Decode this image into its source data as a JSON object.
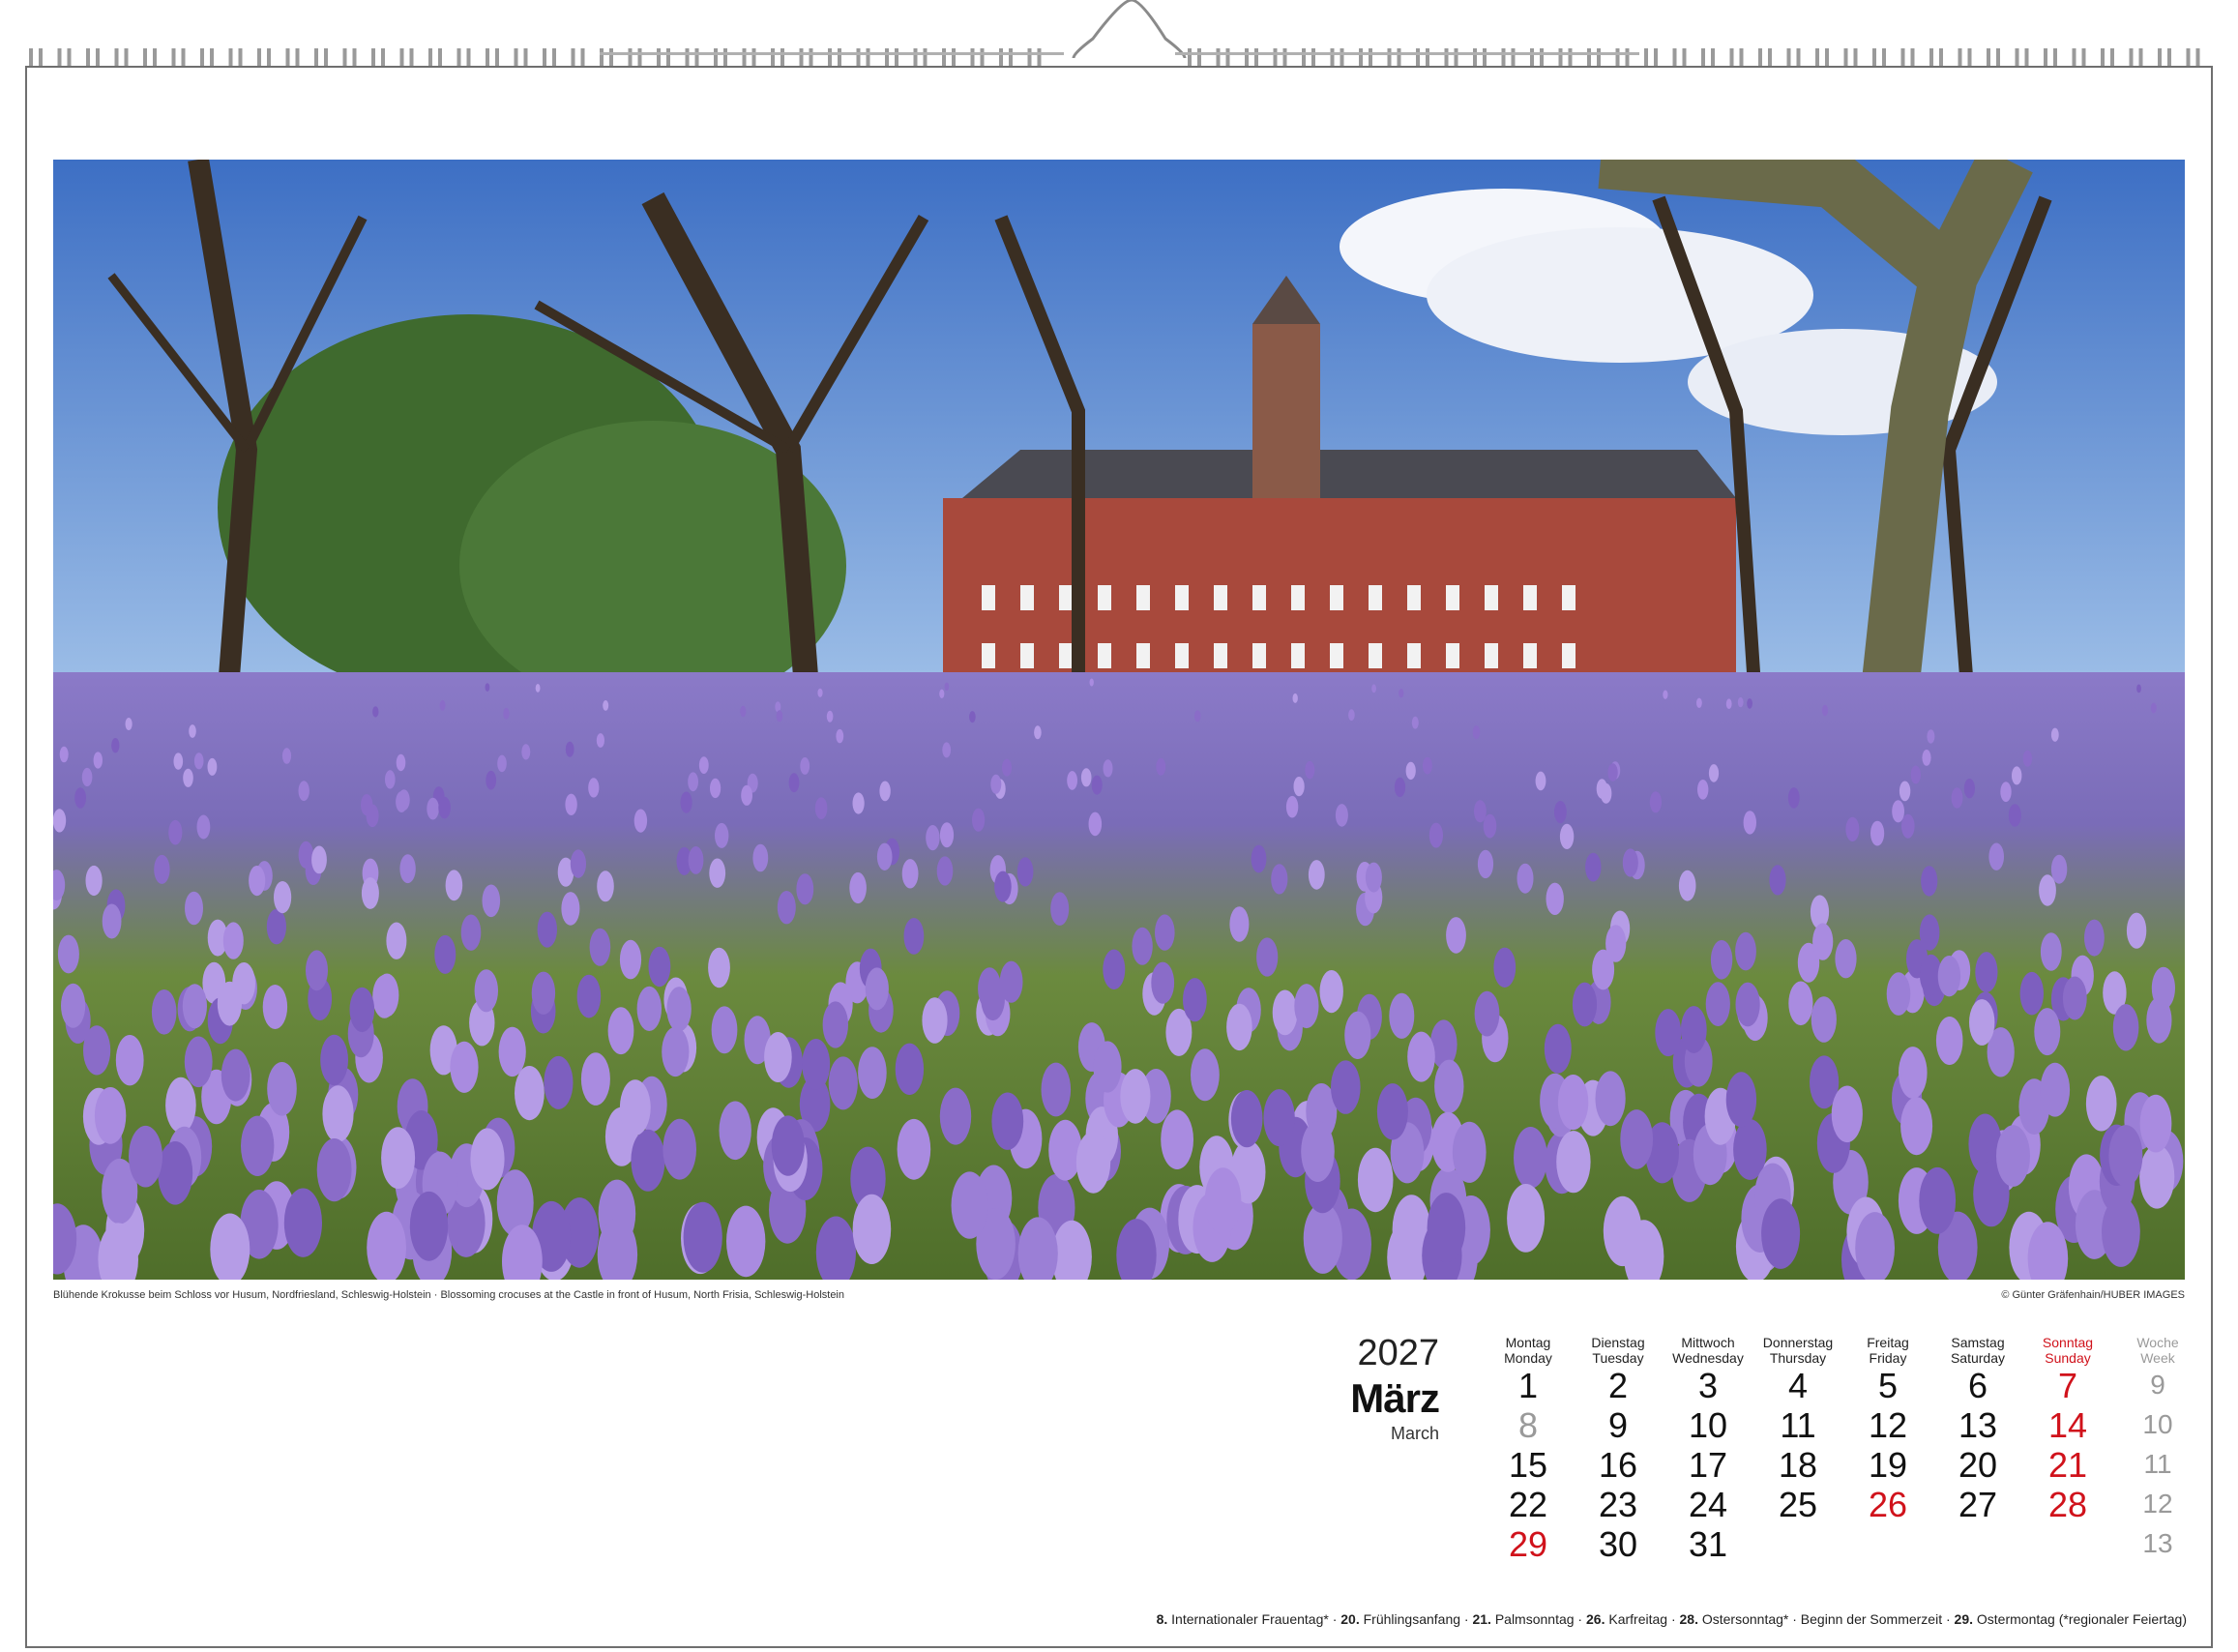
{
  "photo": {
    "caption": "Blühende Krokusse beim Schloss vor Husum, Nordfriesland, Schleswig-Holstein · Blossoming crocuses at the Castle in front of Husum, North Frisia, Schleswig-Holstein",
    "credit": "© Günter Gräfenhain/HUBER IMAGES"
  },
  "header": {
    "year": "2027",
    "month_de": "März",
    "month_en": "March"
  },
  "weekdays": [
    {
      "de": "Montag",
      "en": "Monday"
    },
    {
      "de": "Dienstag",
      "en": "Tuesday"
    },
    {
      "de": "Mittwoch",
      "en": "Wednesday"
    },
    {
      "de": "Donnerstag",
      "en": "Thursday"
    },
    {
      "de": "Freitag",
      "en": "Friday"
    },
    {
      "de": "Samstag",
      "en": "Saturday"
    },
    {
      "de": "Sonntag",
      "en": "Sunday"
    },
    {
      "de": "Woche",
      "en": "Week"
    }
  ],
  "weeks": [
    {
      "days": [
        "1",
        "2",
        "3",
        "4",
        "5",
        "6",
        "7"
      ],
      "week": "9"
    },
    {
      "days": [
        "8",
        "9",
        "10",
        "11",
        "12",
        "13",
        "14"
      ],
      "week": "10"
    },
    {
      "days": [
        "15",
        "16",
        "17",
        "18",
        "19",
        "20",
        "21"
      ],
      "week": "11"
    },
    {
      "days": [
        "22",
        "23",
        "24",
        "25",
        "26",
        "27",
        "28"
      ],
      "week": "12"
    },
    {
      "days": [
        "29",
        "30",
        "31",
        "",
        "",
        "",
        ""
      ],
      "week": "13"
    }
  ],
  "highlight": {
    "holiday_red": [
      "26",
      "29"
    ],
    "gray_days": [
      "8"
    ]
  },
  "colors": {
    "sunday": "#d0121b",
    "week": "#9a9a9a",
    "frame": "#6f6f6f"
  },
  "holidays": [
    {
      "num": "8.",
      "text": "Internationaler Frauentag* · "
    },
    {
      "num": "20.",
      "text": "Frühlingsanfang · "
    },
    {
      "num": "21.",
      "text": "Palmsonntag · "
    },
    {
      "num": "26.",
      "text": "Karfreitag · "
    },
    {
      "num": "28.",
      "text": "Ostersonntag* · Beginn der Sommerzeit · "
    },
    {
      "num": "29.",
      "text": "Ostermontag  (*regionaler Feiertag)"
    }
  ]
}
